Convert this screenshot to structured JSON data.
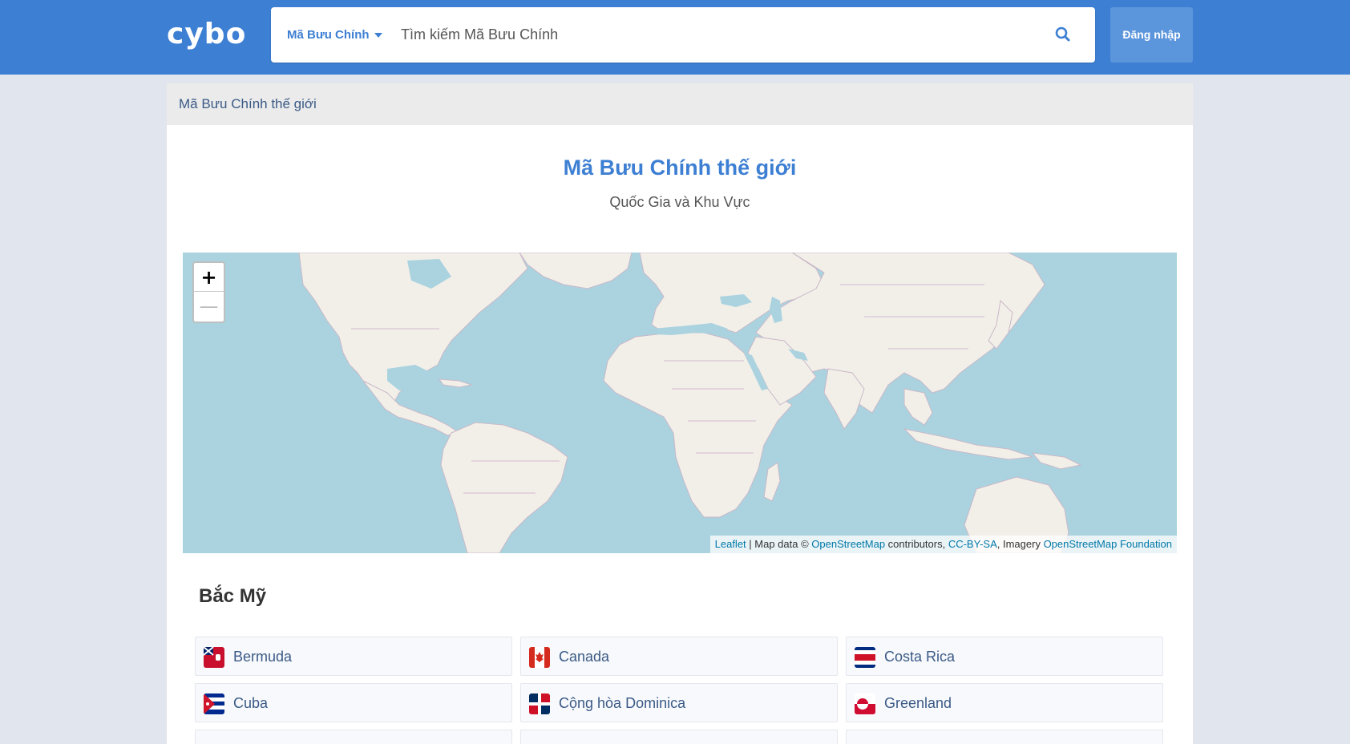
{
  "header": {
    "logo": "cybo",
    "search_scope": "Mã Bưu Chính",
    "search_placeholder": "Tìm kiếm Mã Bưu Chính",
    "login_label": "Đăng nhập"
  },
  "breadcrumb": "Mã Bưu Chính thế giới",
  "page": {
    "title": "Mã Bưu Chính thế giới",
    "subtitle": "Quốc Gia và Khu Vực"
  },
  "map": {
    "zoom_in": "+",
    "zoom_out": "—",
    "attribution": {
      "leaflet": "Leaflet",
      "sep1": " | Map data © ",
      "osm": "OpenStreetMap",
      "contributors": " contributors, ",
      "license": "CC-BY-SA",
      "imagery": ", Imagery ",
      "foundation": "OpenStreetMap Foundation"
    }
  },
  "region": {
    "title": "Bắc Mỹ",
    "countries": [
      {
        "name": "Bermuda",
        "flag": "bermuda-flag-icon"
      },
      {
        "name": "Canada",
        "flag": "canada-flag-icon"
      },
      {
        "name": "Costa Rica",
        "flag": "costa-rica-flag-icon"
      },
      {
        "name": "Cuba",
        "flag": "cuba-flag-icon"
      },
      {
        "name": "Cộng hòa Dominica",
        "flag": "dominican-republic-flag-icon"
      },
      {
        "name": "Greenland",
        "flag": "greenland-flag-icon"
      }
    ]
  },
  "colors": {
    "brand": "#3d7fd3",
    "link": "#3b5a86",
    "water": "#aad3df",
    "land": "#f2efe9"
  }
}
